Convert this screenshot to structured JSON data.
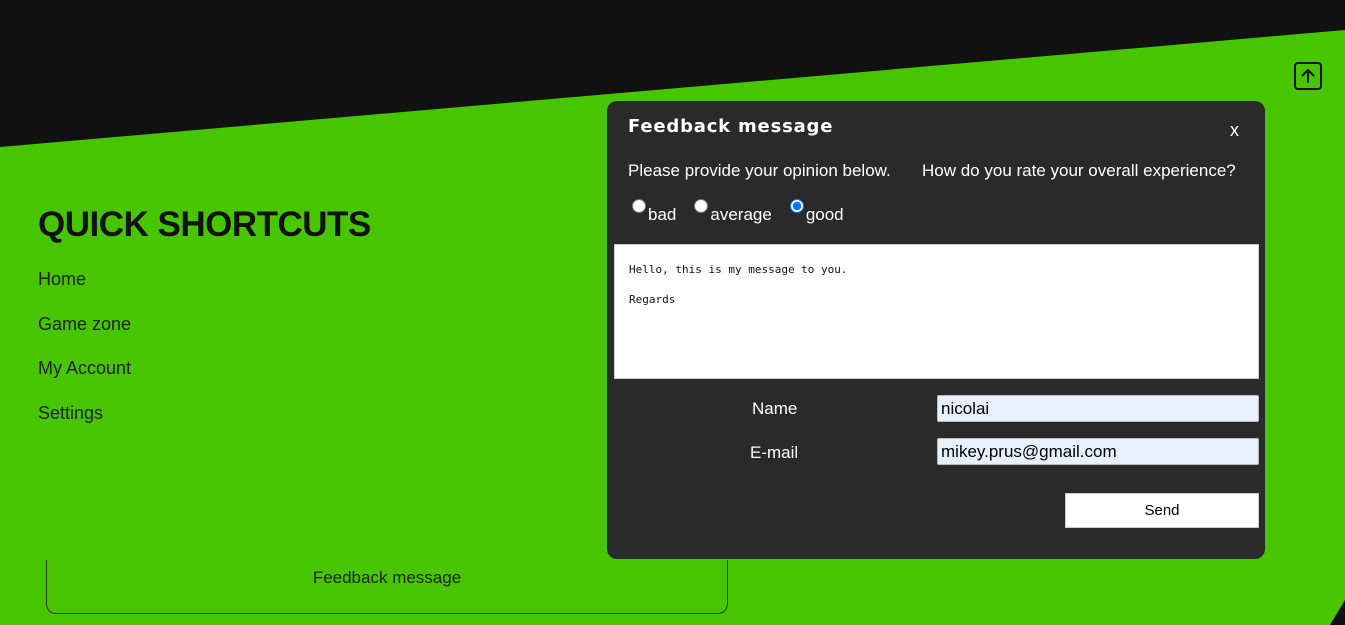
{
  "shortcuts": {
    "title": "QUICK SHORTCUTS",
    "links": [
      "Home",
      "Game zone",
      "My Account",
      "Settings"
    ]
  },
  "feedback_tab": {
    "label": "Feedback message"
  },
  "scroll_top": {
    "icon": "arrow-up-icon"
  },
  "modal": {
    "title": "Feedback message",
    "close_label": "x",
    "prompt_left": "Please provide your opinion below.",
    "prompt_right": "How do you rate your overall experience?",
    "rating": {
      "options": [
        "bad",
        "average",
        "good"
      ],
      "selected": "good"
    },
    "message": "Hello, this is my message to you.\nRegards",
    "name_label": "Name",
    "name_value": "nicolai",
    "email_label": "E-mail",
    "email_value": "mikey.prus@gmail.com",
    "send_label": "Send"
  },
  "colors": {
    "background_green": "#47c600",
    "background_dark": "#111111",
    "modal_bg": "#2a2a2a",
    "input_bg": "#e8f0fe"
  }
}
